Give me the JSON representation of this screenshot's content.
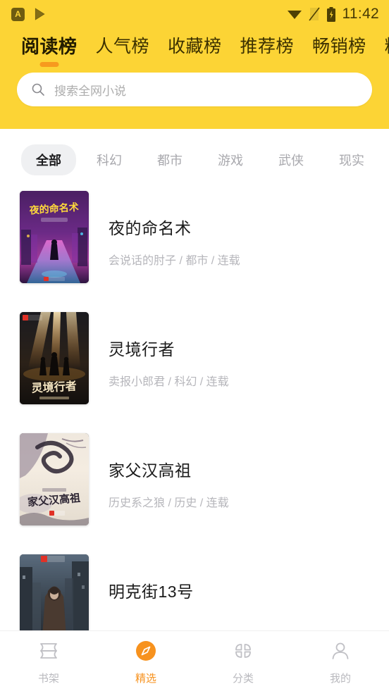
{
  "theme": {
    "header_yellow": "#FCD435",
    "accent_orange": "#F7921E",
    "tab_underline": "#F79A1E",
    "chip_active_bg": "#eff0f2",
    "muted_text": "#b6b6bb"
  },
  "status_bar": {
    "time": "11:42",
    "icons": [
      "app-badge-a-icon",
      "play-store-icon",
      "wifi-icon",
      "no-sim-icon",
      "battery-charging-icon"
    ],
    "app_badge_letter": "A"
  },
  "rank_tabs": [
    {
      "label": "阅读榜",
      "active": true
    },
    {
      "label": "人气榜",
      "active": false
    },
    {
      "label": "收藏榜",
      "active": false
    },
    {
      "label": "推荐榜",
      "active": false
    },
    {
      "label": "畅销榜",
      "active": false
    },
    {
      "label": "粉",
      "active": false
    }
  ],
  "search": {
    "placeholder": "搜索全网小说",
    "value": ""
  },
  "category_chips": [
    {
      "label": "全部",
      "active": true
    },
    {
      "label": "科幻",
      "active": false
    },
    {
      "label": "都市",
      "active": false
    },
    {
      "label": "游戏",
      "active": false
    },
    {
      "label": "武侠",
      "active": false
    },
    {
      "label": "现实",
      "active": false
    }
  ],
  "books": [
    {
      "title": "夜的命名术",
      "author": "会说话的肘子",
      "genre": "都市",
      "status": "连载",
      "subtitle": "会说话的肘子 / 都市 / 连载",
      "cover_alt": "夜的命名术-封面"
    },
    {
      "title": "灵境行者",
      "author": "卖报小郎君",
      "genre": "科幻",
      "status": "连载",
      "subtitle": "卖报小郎君 / 科幻 / 连载",
      "cover_alt": "灵境行者-封面"
    },
    {
      "title": "家父汉高祖",
      "author": "历史系之狼",
      "genre": "历史",
      "status": "连载",
      "subtitle": "历史系之狼 / 历史 / 连载",
      "cover_alt": "家父汉高祖-封面"
    },
    {
      "title": "明克街13号",
      "author": "",
      "genre": "",
      "status": "",
      "subtitle": "",
      "cover_alt": "明克街13号-封面"
    }
  ],
  "bottom_nav": [
    {
      "label": "书架",
      "icon": "bookshelf-icon",
      "active": false
    },
    {
      "label": "精选",
      "icon": "compass-icon",
      "active": true
    },
    {
      "label": "分类",
      "icon": "grid-petals-icon",
      "active": false
    },
    {
      "label": "我的",
      "icon": "person-icon",
      "active": false
    }
  ]
}
